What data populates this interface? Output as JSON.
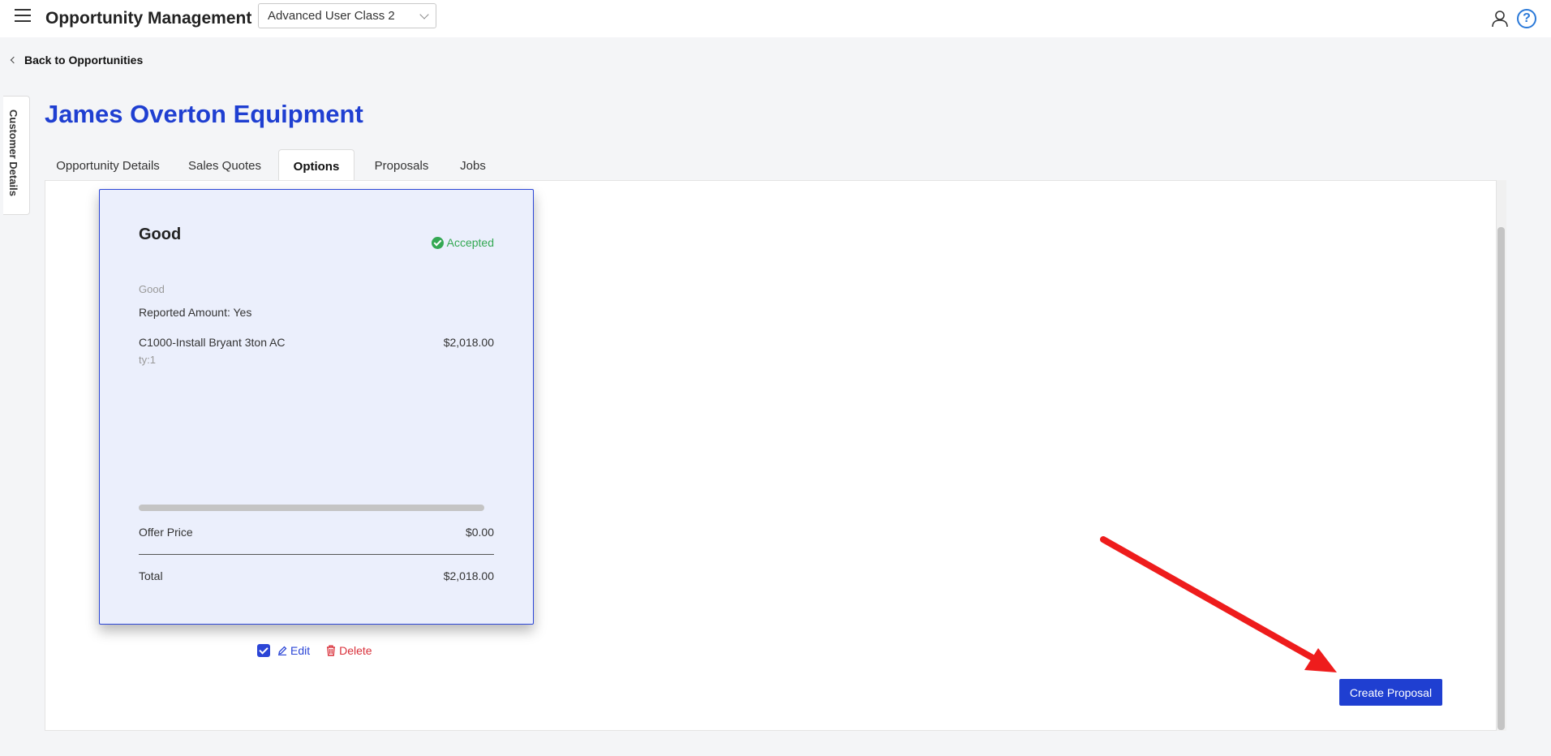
{
  "header": {
    "app_title": "Opportunity Management",
    "user_class": "Advanced User Class 2",
    "help_label": "?"
  },
  "nav": {
    "back_label": "Back to Opportunities",
    "side_tab_label": "Customer Details"
  },
  "page": {
    "title": "James Overton Equipment"
  },
  "tabs": [
    {
      "label": "Opportunity Details",
      "active": false
    },
    {
      "label": "Sales Quotes",
      "active": false
    },
    {
      "label": "Options",
      "active": true
    },
    {
      "label": "Proposals",
      "active": false
    },
    {
      "label": "Jobs",
      "active": false
    }
  ],
  "option_card": {
    "title": "Good",
    "status": "Accepted",
    "subtitle": "Good",
    "reported_amount": "Reported Amount: Yes",
    "line_item": {
      "name": "C1000-Install Bryant 3ton AC",
      "price": "$2,018.00",
      "qty": "ty:1"
    },
    "offer_price_label": "Offer Price",
    "offer_price_value": "$0.00",
    "total_label": "Total",
    "total_value": "$2,018.00",
    "actions": {
      "selected": true,
      "edit_label": "Edit",
      "delete_label": "Delete"
    }
  },
  "footer": {
    "create_proposal_label": "Create Proposal"
  },
  "colors": {
    "brand_blue": "#1f3fd1",
    "accepted_green": "#34a853",
    "delete_red": "#d9303a",
    "annotation_red": "#ee1c1c"
  },
  "icons": [
    "hamburger-icon",
    "chevron-down-icon",
    "user-icon",
    "help-icon",
    "chevron-left-icon",
    "check-circle-icon",
    "checkbox-icon",
    "pencil-icon",
    "trash-icon",
    "annotation-arrow"
  ]
}
